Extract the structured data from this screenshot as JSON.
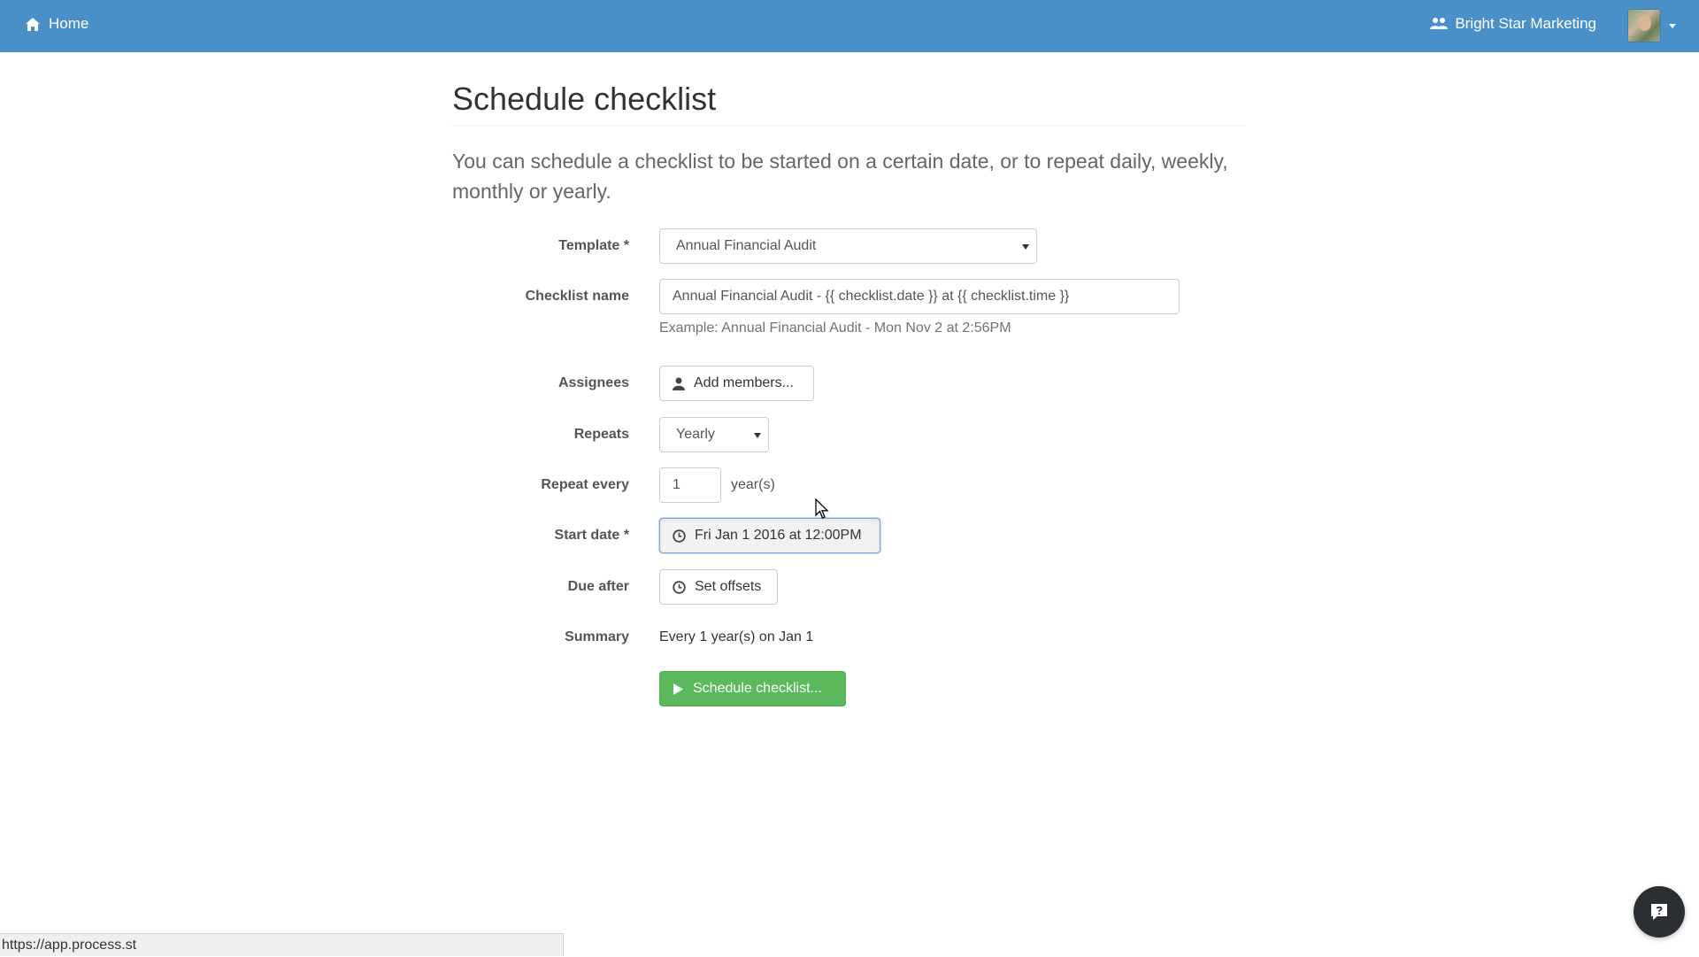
{
  "navbar": {
    "home_label": "Home",
    "org_label": "Bright Star Marketing",
    "color": "#4a90c8"
  },
  "page": {
    "title": "Schedule checklist",
    "lead": "You can schedule a checklist to be started on a certain date, or to repeat daily, weekly, monthly or yearly."
  },
  "form": {
    "template": {
      "label": "Template *",
      "value": "Annual Financial Audit"
    },
    "checklist_name": {
      "label": "Checklist name",
      "value": "Annual Financial Audit - {{ checklist.date }} at {{ checklist.time }}",
      "help": "Example: Annual Financial Audit - Mon Nov 2 at 2:56PM"
    },
    "assignees": {
      "label": "Assignees",
      "button": "Add members..."
    },
    "repeats": {
      "label": "Repeats",
      "value": "Yearly"
    },
    "repeat_every": {
      "label": "Repeat every",
      "value": "1",
      "suffix": "year(s)"
    },
    "start_date": {
      "label": "Start date *",
      "value": "Fri Jan 1 2016 at 12:00PM"
    },
    "due_after": {
      "label": "Due after",
      "button": "Set offsets"
    },
    "summary": {
      "label": "Summary",
      "value": "Every 1 year(s) on Jan 1"
    },
    "submit": {
      "label": "Schedule checklist...",
      "color": "#5cb85c"
    }
  },
  "statusbar": {
    "url": "https://app.process.st"
  },
  "icons": {
    "home": "home-icon",
    "org": "users-icon",
    "user": "user-icon",
    "clock": "clock-icon",
    "play": "play-icon",
    "help": "question-icon"
  }
}
